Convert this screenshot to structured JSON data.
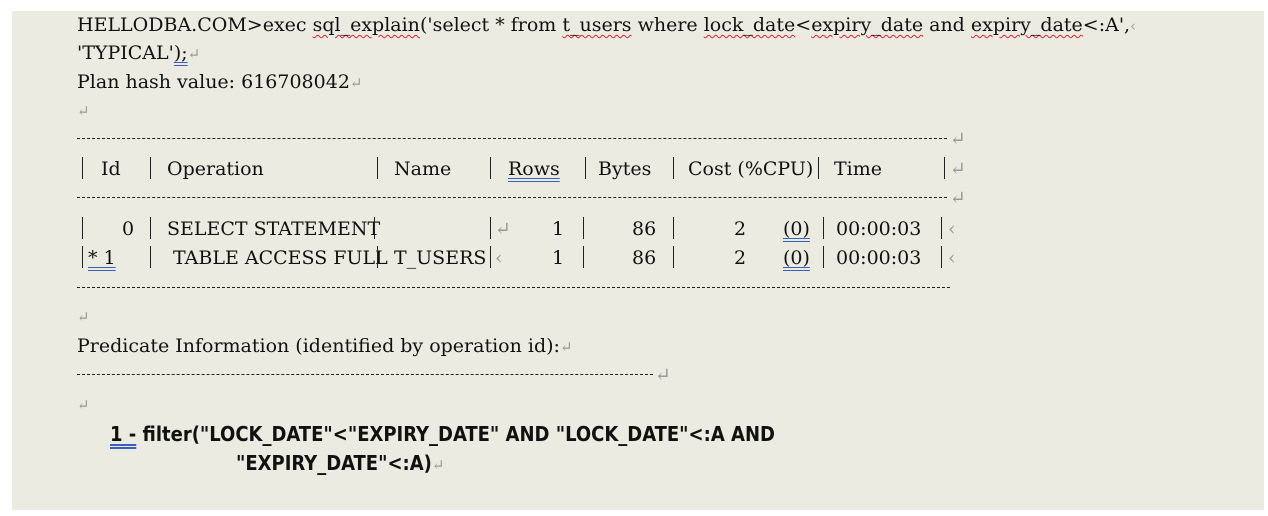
{
  "command": {
    "prompt": "HELLODBA.COM>exec ",
    "fn": "sql_explain",
    "open": "('select * from ",
    "table": "t_users",
    "where": " where ",
    "col1": "lock_date",
    "lt": "<",
    "col2": "expiry_date",
    "and": " and ",
    "col3": "expiry_date",
    "tail": "<:A',",
    "line2": "'TYPICAL'",
    "end": ");"
  },
  "plan_hash": "Plan hash value: 616708042",
  "table": {
    "headers": [
      "Id",
      "Operation",
      "Name",
      "Rows",
      "Bytes",
      "Cost (%CPU)",
      "Time"
    ],
    "rows": [
      {
        "id": "0",
        "operation": "SELECT STATEMENT",
        "name": "",
        "rows": "1",
        "bytes": "86",
        "cost": "2",
        "cpu": "(0)",
        "time": "00:00:03"
      },
      {
        "id": "* 1",
        "operation": " TABLE ACCESS FULL",
        "name": "T_USERS",
        "rows": "1",
        "bytes": "86",
        "cost": "2",
        "cpu": "(0)",
        "time": "00:00:03"
      }
    ]
  },
  "predicate": {
    "title": "Predicate Information (identified by operation id):",
    "num": "1 -",
    "line1": " filter(\"LOCK_DATE\"<\"EXPIRY_DATE\" AND \"LOCK_DATE\"<:A AND",
    "line2": "\"EXPIRY_DATE\"<:A)"
  }
}
